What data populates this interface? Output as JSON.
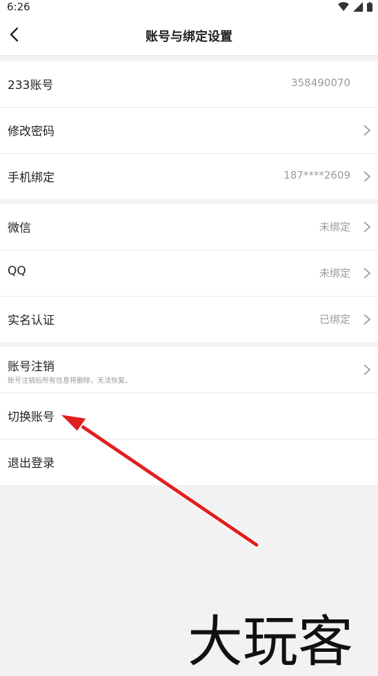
{
  "status_bar": {
    "time": "6:26"
  },
  "header": {
    "title": "账号与绑定设置"
  },
  "groups": [
    {
      "rows": [
        {
          "label": "233账号",
          "value": "358490070"
        },
        {
          "label": "修改密码",
          "value": ""
        },
        {
          "label": "手机绑定",
          "value": "187****2609"
        }
      ]
    },
    {
      "rows": [
        {
          "label": "微信",
          "value": "未绑定"
        },
        {
          "label": "QQ",
          "value": "未绑定"
        },
        {
          "label": "实名认证",
          "value": "已绑定"
        }
      ]
    },
    {
      "rows": [
        {
          "label": "账号注销",
          "subtitle": "账号注销后所有信息将删除，无法恢复。"
        },
        {
          "label": "切换账号"
        },
        {
          "label": "退出登录"
        }
      ]
    }
  ],
  "watermark": {
    "text": "大玩客"
  },
  "colors": {
    "annotation_arrow": "#e02020",
    "page_bg": "#f2f2f2"
  }
}
